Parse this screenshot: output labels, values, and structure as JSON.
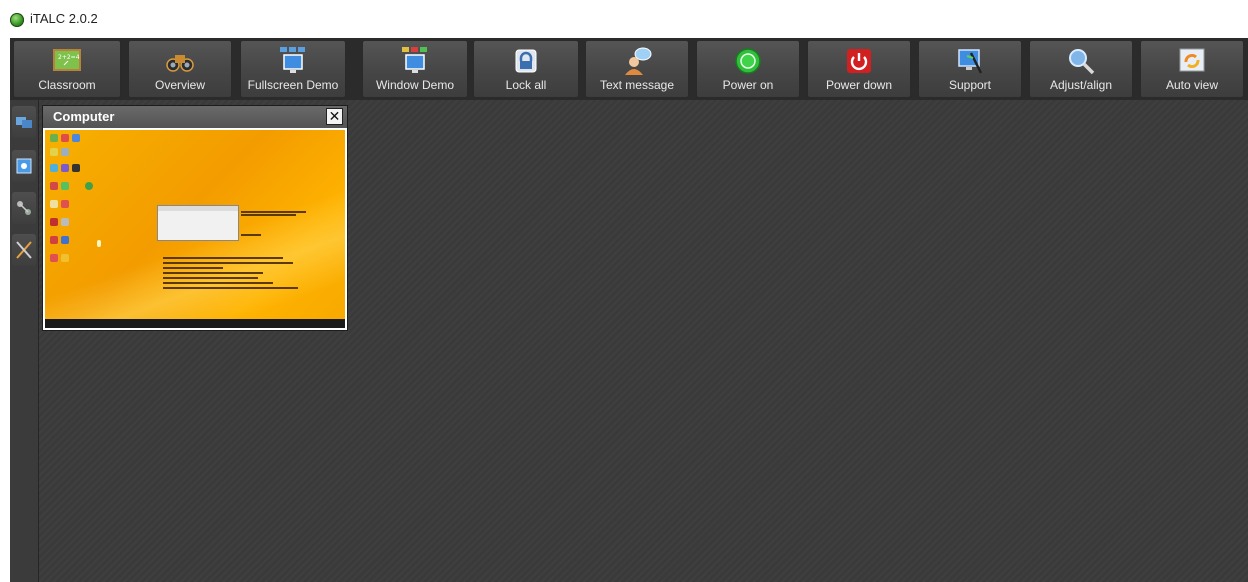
{
  "window": {
    "title": "iTALC 2.0.2"
  },
  "toolbar": {
    "buttons": [
      {
        "label": "Classroom",
        "icon": "chalkboard-icon"
      },
      {
        "label": "Overview",
        "icon": "binoculars-icon"
      },
      {
        "label": "Fullscreen Demo",
        "icon": "fullscreen-demo-icon"
      },
      {
        "label": "Window Demo",
        "icon": "window-demo-icon"
      },
      {
        "label": "Lock all",
        "icon": "lock-icon"
      },
      {
        "label": "Text message",
        "icon": "text-message-icon"
      },
      {
        "label": "Power on",
        "icon": "power-on-icon"
      },
      {
        "label": "Power down",
        "icon": "power-down-icon"
      },
      {
        "label": "Support",
        "icon": "support-icon"
      },
      {
        "label": "Adjust/align",
        "icon": "magnifier-icon"
      },
      {
        "label": "Auto view",
        "icon": "auto-view-icon"
      }
    ]
  },
  "sidebar": {
    "items": [
      {
        "icon": "computers-icon"
      },
      {
        "icon": "snapshots-icon"
      },
      {
        "icon": "network-icon"
      },
      {
        "icon": "tools-icon"
      }
    ]
  },
  "computer_panel": {
    "title": "Computer",
    "close_symbol": "✕"
  },
  "colors": {
    "toolbar_bg": "#2b2b2b",
    "workspace_bg": "#3a3a3a",
    "screen_orange": "#f7a800",
    "power_on_green": "#2fbf3a",
    "power_down_red": "#d22020"
  }
}
